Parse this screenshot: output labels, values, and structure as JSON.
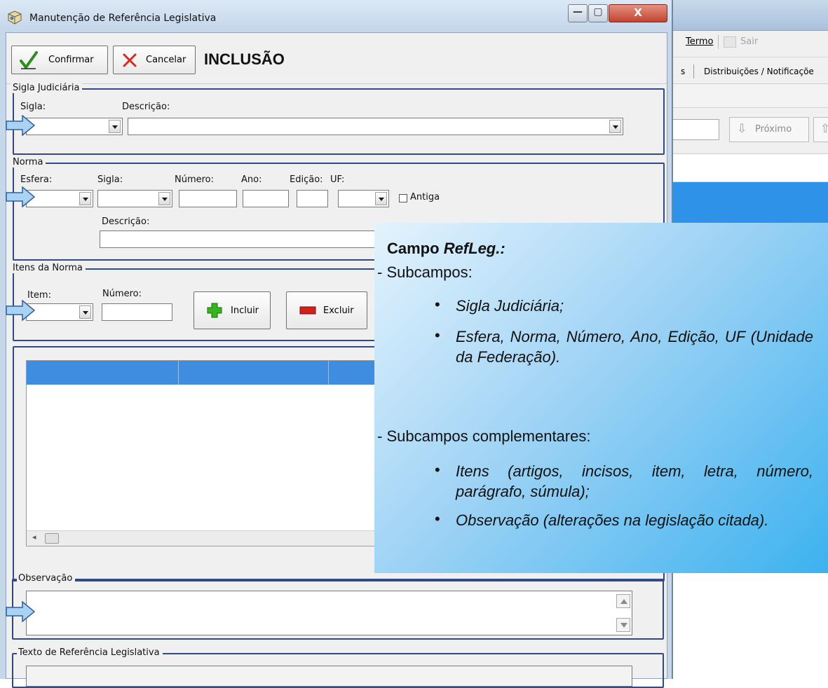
{
  "background_app": {
    "menu_termo": "Termo",
    "menu_sair": "Sair",
    "tab_partial": "s",
    "tab_distribuicoes": "Distribuições / Notificaçõe",
    "next_button": "Próximo"
  },
  "window": {
    "title": "Manutenção de Referência Legislativa",
    "minimize_glyph": "—",
    "maximize_glyph": "▢",
    "close_glyph": "X"
  },
  "toolbar": {
    "confirm_label": "Confirmar",
    "cancel_label": "Cancelar",
    "mode": "INCLUSÃO"
  },
  "sigla_judiciaria": {
    "group_title": "Sigla Judiciária",
    "sigla_label": "Sigla:",
    "descricao_label": "Descrição:"
  },
  "norma": {
    "group_title": "Norma",
    "esfera_label": "Esfera:",
    "sigla_label": "Sigla:",
    "numero_label": "Número:",
    "ano_label": "Ano:",
    "edicao_label": "Edição:",
    "uf_label": "UF:",
    "antiga_label": "Antiga",
    "descricao_label": "Descrição:"
  },
  "itens_norma": {
    "group_title": "Itens da Norma",
    "item_label": "Item:",
    "numero_label": "Número:",
    "incluir_label": "Incluir",
    "excluir_label": "Excluir"
  },
  "observacao": {
    "group_title": "Observação"
  },
  "texto_referencia": {
    "group_title": "Texto de Referência Legislativa"
  },
  "callout": {
    "title_prefix": "Campo ",
    "title_em": "RefLeg.:",
    "subcampos_heading": "- Subcampos:",
    "subcampos": [
      "Sigla Judiciária;",
      "Esfera, Norma, Número, Ano, Edição, UF (Unidade da Federação)."
    ],
    "complementares_heading": "- Subcampos complementares:",
    "complementares": [
      "Itens (artigos, incisos, item, letra, número, parágrafo, súmula);",
      "Observação (alterações na legislação citada)."
    ]
  },
  "colors": {
    "group_border": "#304a86",
    "grid_header": "#3f8de0",
    "arrow_fill": "#a9d2f3",
    "arrow_stroke": "#2d5f9e"
  }
}
